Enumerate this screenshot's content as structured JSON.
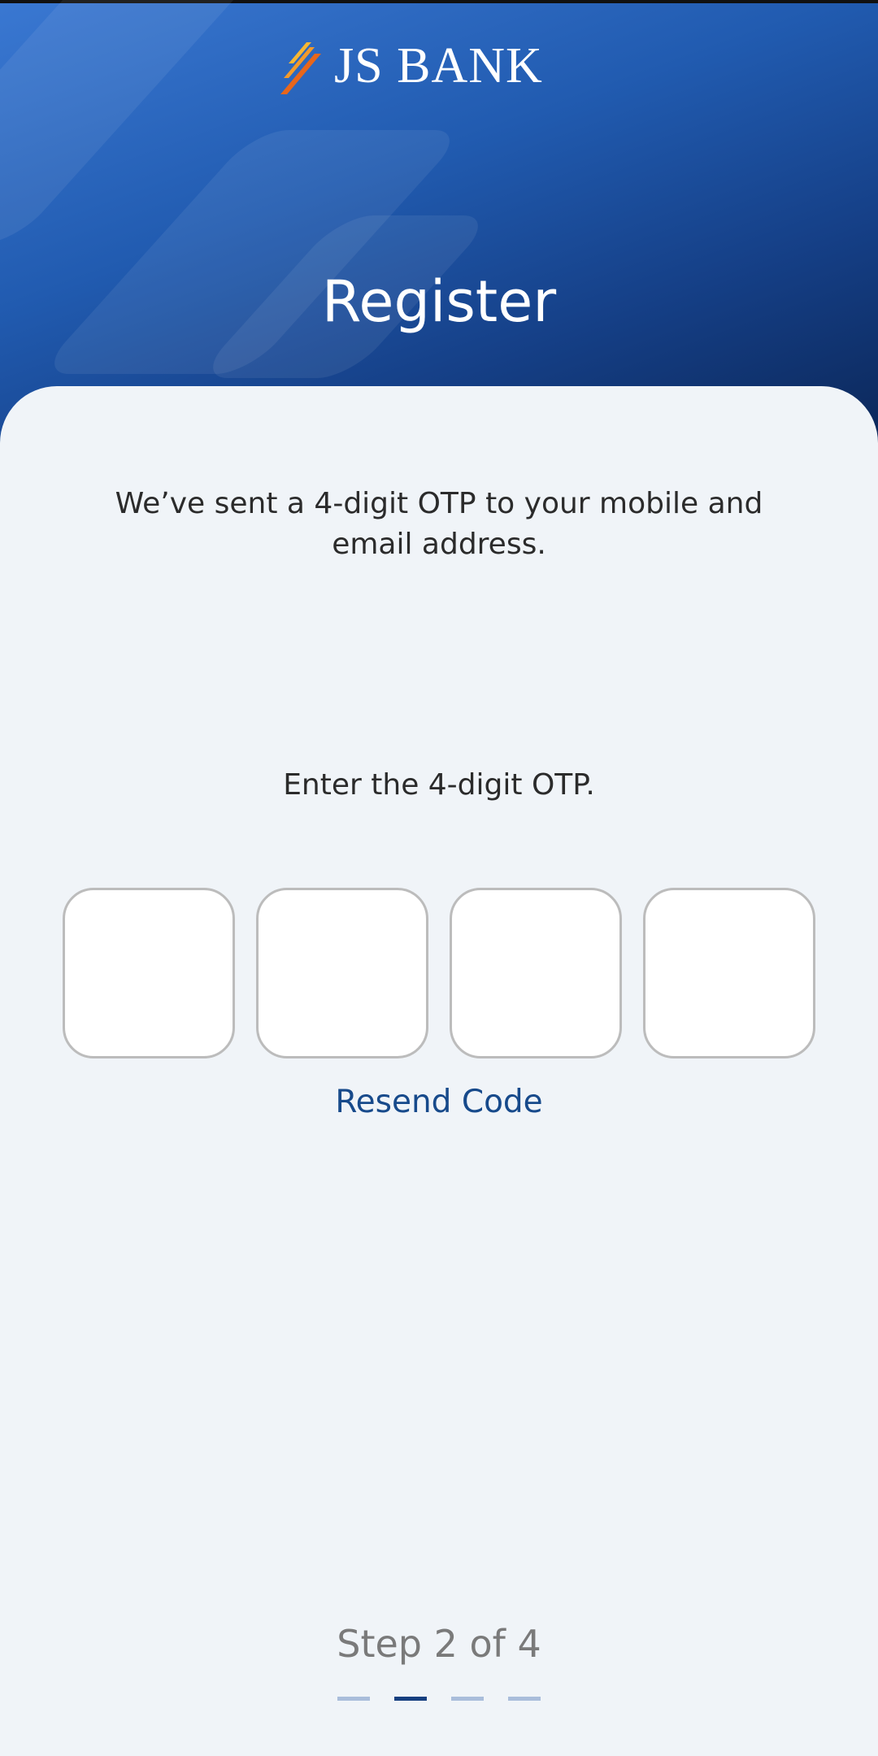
{
  "brand": {
    "logo_text": "JS BANK",
    "primary_color": "#174a8b",
    "accent_colors": [
      "#f7b733",
      "#e8661b"
    ]
  },
  "header": {
    "title": "Register"
  },
  "otp": {
    "info_text": "We’ve sent a 4-digit OTP to your mobile and email address.",
    "prompt": "Enter the 4-digit OTP.",
    "digits": [
      "",
      "",
      "",
      ""
    ],
    "resend_label": "Resend Code"
  },
  "progress": {
    "label": "Step 2 of 4",
    "current_step": 2,
    "total_steps": 4
  }
}
